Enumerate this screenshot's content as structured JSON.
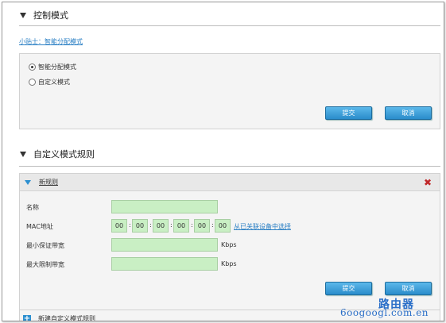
{
  "control_mode": {
    "heading": "控制模式",
    "tip_link": "小贴士：智能分配模式",
    "options": [
      {
        "label": "智能分配模式",
        "selected": true
      },
      {
        "label": "自定义模式",
        "selected": false
      }
    ],
    "submit_label": "提交",
    "cancel_label": "取消"
  },
  "custom_rules": {
    "heading": "自定义模式规则",
    "rule_title": "新规则",
    "fields": {
      "name_label": "名称",
      "name_value": "",
      "mac_label": "MAC地址",
      "mac_octets": [
        "00",
        "00",
        "00",
        "00",
        "00",
        "00"
      ],
      "mac_separator": ":",
      "mac_select_link": "从已关联设备中选择",
      "min_bw_label": "最小保证带宽",
      "min_bw_value": "",
      "max_bw_label": "最大限制带宽",
      "max_bw_value": "",
      "unit": "Kbps"
    },
    "submit_label": "提交",
    "cancel_label": "取消",
    "add_rule_label": "新建自定义模式规则"
  },
  "watermark": {
    "cn": "路由器",
    "en": "6oogoogl.com.en"
  },
  "colors": {
    "accent": "#2c8fd0",
    "button": "#3a9ad6",
    "field_bg": "#c9efc4",
    "close": "#c0282a",
    "link": "#2a7fc4"
  }
}
